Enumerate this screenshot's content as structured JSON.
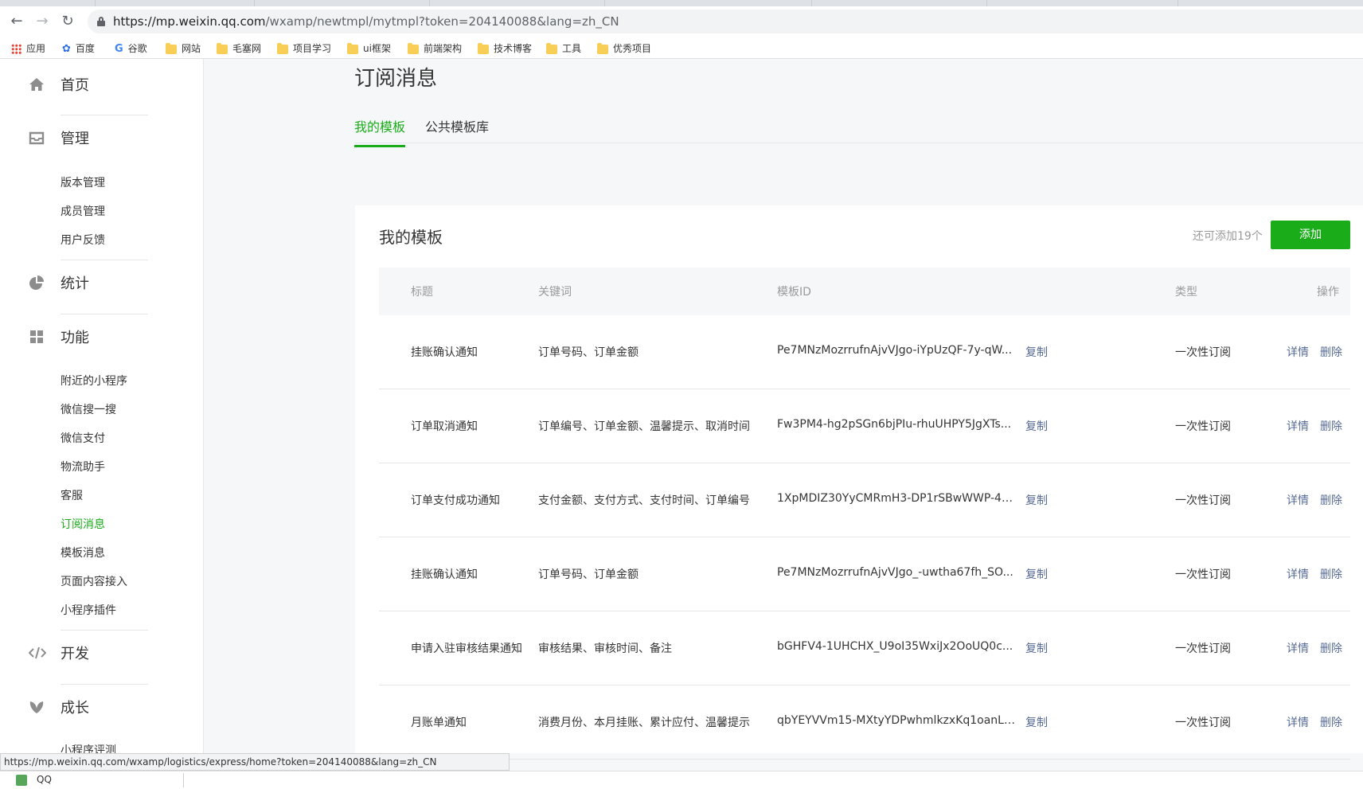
{
  "browser": {
    "url_host": "https://mp.weixin.qq.com",
    "url_path": "/wxamp/newtmpl/mytmpl?token=204140088&lang=zh_CN",
    "bookmarks": [
      {
        "label": "应用",
        "icon": "apps-icon"
      },
      {
        "label": "百度",
        "icon": "paw-icon"
      },
      {
        "label": "谷歌",
        "icon": "google-icon"
      },
      {
        "label": "网站",
        "icon": "folder-icon"
      },
      {
        "label": "毛塞网",
        "icon": "folder-icon"
      },
      {
        "label": "项目学习",
        "icon": "folder-icon"
      },
      {
        "label": "ui框架",
        "icon": "folder-icon"
      },
      {
        "label": "前端架构",
        "icon": "folder-icon"
      },
      {
        "label": "技术博客",
        "icon": "folder-icon"
      },
      {
        "label": "工具",
        "icon": "folder-icon"
      },
      {
        "label": "优秀项目",
        "icon": "folder-icon"
      }
    ],
    "status_url": "https://mp.weixin.qq.com/wxamp/logistics/express/home?token=204140088&lang=zh_CN"
  },
  "sidebar": {
    "groups": [
      {
        "label": "首页",
        "icon": "home-icon"
      },
      {
        "label": "管理",
        "icon": "inbox-icon"
      },
      {
        "label": "统计",
        "icon": "pie-chart-icon"
      },
      {
        "label": "功能",
        "icon": "grid-icon"
      },
      {
        "label": "开发",
        "icon": "code-icon"
      },
      {
        "label": "成长",
        "icon": "leaf-icon"
      }
    ],
    "manage_items": [
      "版本管理",
      "成员管理",
      "用户反馈"
    ],
    "feature_items": [
      "附近的小程序",
      "微信搜一搜",
      "微信支付",
      "物流助手",
      "客服",
      "订阅消息",
      "模板消息",
      "页面内容接入",
      "小程序插件"
    ],
    "growth_items": [
      "小程序评测"
    ],
    "active_item": "订阅消息"
  },
  "main": {
    "title": "订阅消息",
    "tabs": [
      {
        "label": "我的模板",
        "active": true
      },
      {
        "label": "公共模板库",
        "active": false
      }
    ],
    "panel": {
      "title": "我的模板",
      "quota": "还可添加19个",
      "add_label": "添加"
    },
    "table": {
      "headers": [
        "标题",
        "关键词",
        "模板ID",
        "类型",
        "操作"
      ],
      "copy_label": "复制",
      "detail_label": "详情",
      "delete_label": "删除",
      "rows": [
        {
          "title": "挂账确认通知",
          "keywords": "订单号码、订单金额",
          "id": "Pe7MNzMozrrufnAjvVJgo-iYpUzQF-7y-qW...",
          "type": "一次性订阅"
        },
        {
          "title": "订单取消通知",
          "keywords": "订单编号、订单金额、温馨提示、取消时间",
          "id": "Fw3PM4-hg2pSGn6bjPIu-rhuUHPY5JgXTs...",
          "type": "一次性订阅"
        },
        {
          "title": "订单支付成功通知",
          "keywords": "支付金额、支付方式、支付时间、订单编号",
          "id": "1XpMDIZ30YyCMRmH3-DP1rSBwWWP-4K...",
          "type": "一次性订阅"
        },
        {
          "title": "挂账确认通知",
          "keywords": "订单号码、订单金额",
          "id": "Pe7MNzMozrrufnAjvVJgo_-uwtha67fh_SO...",
          "type": "一次性订阅"
        },
        {
          "title": "申请入驻审核结果通知",
          "keywords": "审核结果、审核时间、备注",
          "id": "bGHFV4-1UHCHX_U9oI35WxiJx2OoUQ0c...",
          "type": "一次性订阅"
        },
        {
          "title": "月账单通知",
          "keywords": "消费月份、本月挂账、累计应付、温馨提示",
          "id": "qbYEYVVm15-MXtyYDPwhmlkzxKq1oanL8...",
          "type": "一次性订阅"
        }
      ]
    }
  },
  "taskbar": {
    "label": "QQ"
  },
  "colors": {
    "accent": "#1aad19",
    "link": "#576b95",
    "muted": "#9a9a9a"
  }
}
